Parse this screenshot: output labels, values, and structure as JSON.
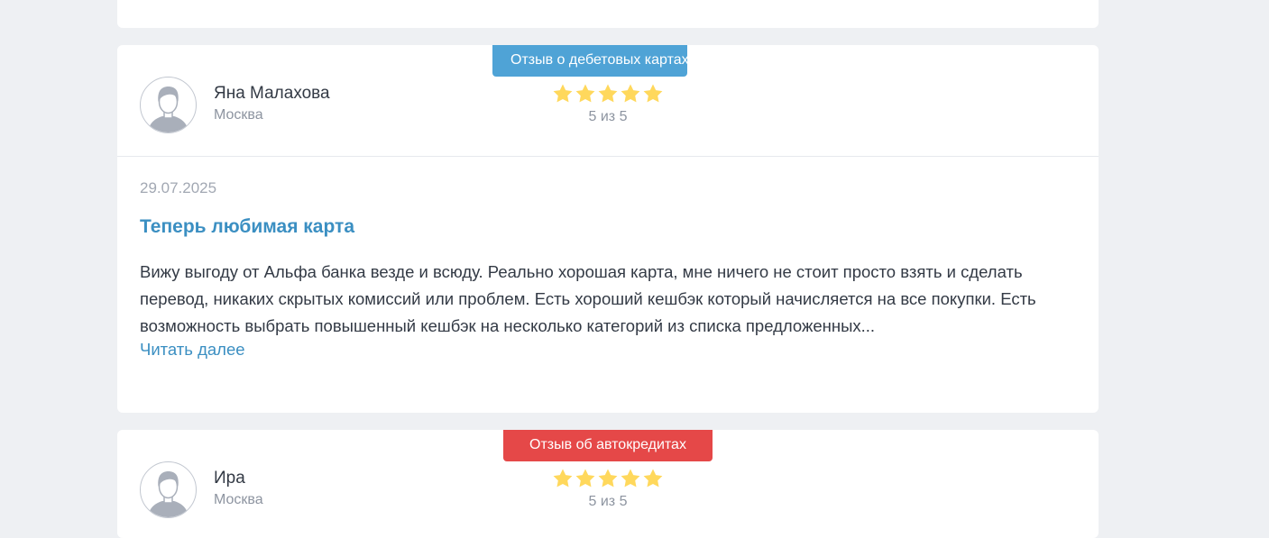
{
  "reviews": [
    {
      "badge": "Отзыв о дебетовых картах",
      "badge_color": "#4fa3d6",
      "author": "Яна Малахова",
      "city": "Москва",
      "stars": 5,
      "rating_text": "5 из 5",
      "date": "29.07.2025",
      "title": "Теперь любимая карта",
      "text": "Вижу выгоду от Альфа банка везде и всюду. Реально хорошая карта, мне ничего не стоит просто взять и сделать перевод, никаких скрытых комиссий или проблем. Есть хороший кешбэк который начисляется на все покупки. Есть возможность выбрать повышенный кешбэк на несколько категорий из списка предложенных...",
      "read_more": "Читать далее"
    },
    {
      "badge": "Отзыв об автокредитах",
      "badge_color": "#e54848",
      "author": "Ира",
      "city": "Москва",
      "stars": 5,
      "rating_text": "5 из 5"
    }
  ],
  "colors": {
    "star": "#ffd85c",
    "link": "#3b8fc2",
    "background": "#eef0f3"
  },
  "icons": {
    "avatar": "user-silhouette-icon",
    "star": "star-icon"
  }
}
